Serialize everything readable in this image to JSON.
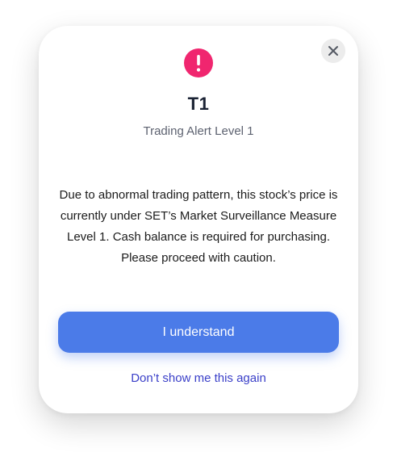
{
  "dialog": {
    "title": "T1",
    "subtitle": "Trading Alert Level 1",
    "message": "Due to abnormal trading pattern, this stock’s price is currently under SET’s Market Surveillance Measure Level 1. Cash balance is required for purchasing. Please proceed with caution.",
    "primary_button_label": "I understand",
    "secondary_link_label": "Don’t show me this again",
    "icons": {
      "alert": "exclamation-circle-icon",
      "close": "close-icon"
    },
    "colors": {
      "alert_icon": "#f0266f",
      "primary_button": "#4b7be8",
      "link": "#3a3fc8"
    }
  }
}
